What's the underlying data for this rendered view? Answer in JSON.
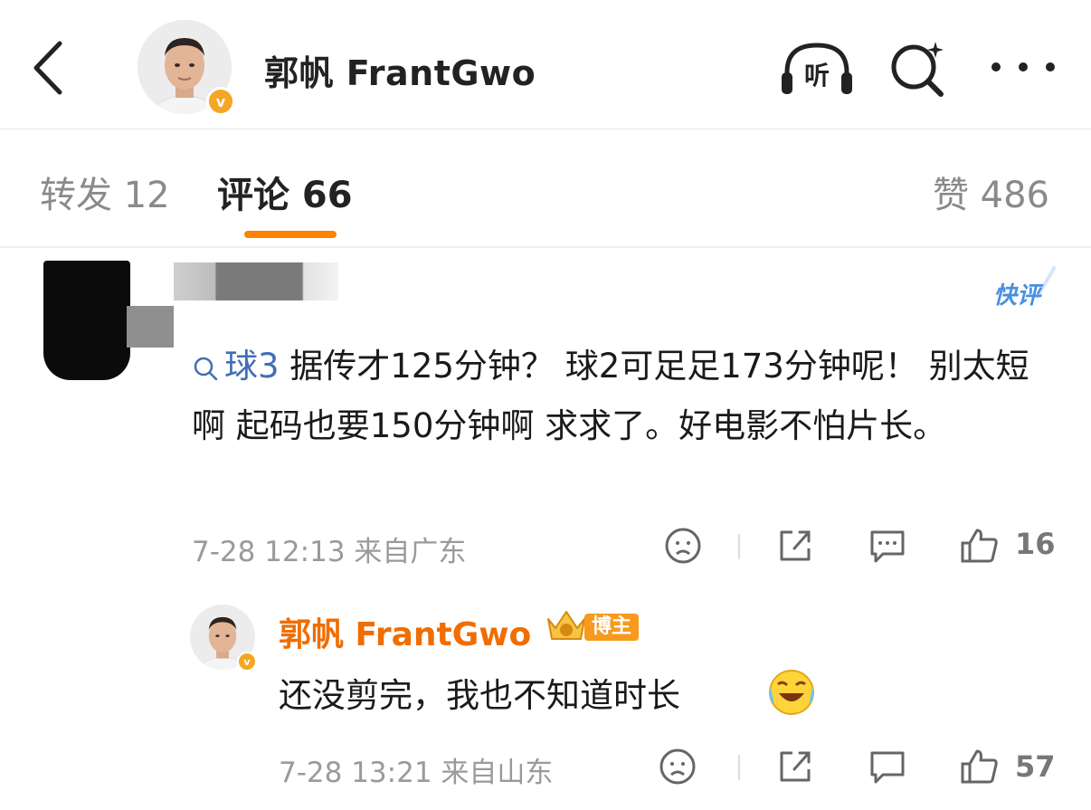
{
  "header": {
    "title": "郭帆 FrantGwo",
    "verify_mark": "v",
    "listen_label": "听"
  },
  "tabs": {
    "repost": "转发 12",
    "comment": "评论 66",
    "like": "赞 486"
  },
  "comment": {
    "badge": "快评",
    "topic": "球3",
    "text": " 据传才125分钟？  球2可足足173分钟呢！  别太短啊 起码也要150分钟啊  求求了。好电影不怕片长。",
    "time": "7-28 12:13",
    "location": "来自广东",
    "likes": "16"
  },
  "reply": {
    "author": "郭帆 FrantGwo",
    "author_badge": "博主",
    "text": "还没剪完，我也不知道时长",
    "time": "7-28 13:21",
    "location": "来自山东",
    "likes": "57"
  },
  "colors": {
    "accent": "#ff8200",
    "topic": "#3f6fb3",
    "author": "#f06d00",
    "meta": "#9a9a9a"
  }
}
